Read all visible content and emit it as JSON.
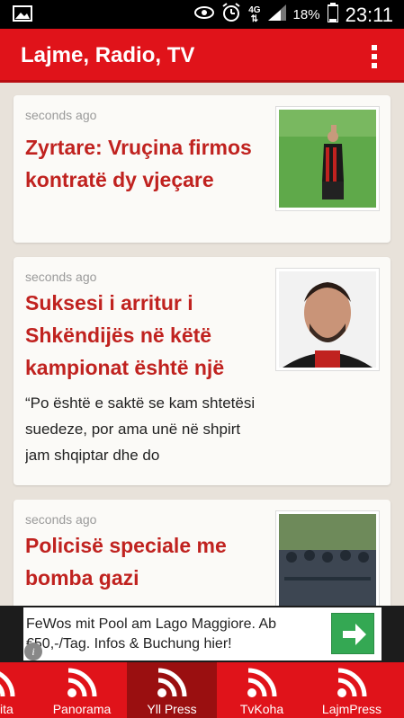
{
  "status_bar": {
    "battery_percent": "18%",
    "network_label": "4G",
    "time": "23:11"
  },
  "app_bar": {
    "title": "Lajme, Radio, TV"
  },
  "articles": [
    {
      "time": "seconds ago",
      "title": "Zyrtare: Vruçina firmos kontratë dy vjeçare",
      "excerpt": ""
    },
    {
      "time": "seconds ago",
      "title": "Suksesi i arritur i Shkëndijës në këtë kampionat është një",
      "excerpt": "“Po është e saktë se kam shtetësi suedeze, por ama unë në shpirt jam shqiptar dhe do"
    },
    {
      "time": "seconds ago",
      "title": "Policisë speciale me bomba gazi",
      "excerpt": ""
    }
  ],
  "ad": {
    "text": "FeWos mit Pool am Lago Maggiore. Ab €50,-/Tag. Infos & Buchung hier!",
    "info_glyph": "i",
    "go_icon": "arrow-right-icon",
    "button_color": "#34a853"
  },
  "bottom_nav": {
    "tabs": [
      {
        "label": "ita",
        "icon": "rss-icon",
        "active": false
      },
      {
        "label": "Panorama",
        "icon": "rss-icon",
        "active": false
      },
      {
        "label": "Yll Press",
        "icon": "rss-icon",
        "active": true
      },
      {
        "label": "TvKoha",
        "icon": "rss-icon",
        "active": false
      },
      {
        "label": "LajmPress",
        "icon": "rss-icon",
        "active": false
      }
    ]
  },
  "colors": {
    "brand_red": "#e0131a",
    "active_tab": "#9a0f10",
    "headline_red": "#c0221f"
  }
}
